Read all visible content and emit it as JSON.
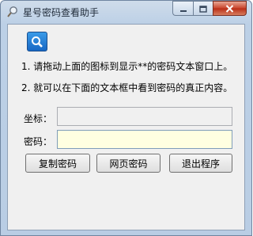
{
  "window": {
    "title": "星号密码查看助手"
  },
  "caption_buttons": {
    "minimize_icon": "minimize-icon",
    "maximize_icon": "maximize-icon",
    "close_icon": "close-icon"
  },
  "finder": {
    "icon": "magnifier-icon",
    "color": "#1e78d6"
  },
  "instructions": {
    "line1": "1. 请拖动上面的图标到显示**的密码文本窗口上。",
    "line2": "2. 就可以在下面的文本框中看到密码的真正内容。"
  },
  "fields": {
    "coord_label": "坐标：",
    "coord_value": "",
    "password_label": "密码：",
    "password_value": ""
  },
  "buttons": {
    "copy_password": "复制密码",
    "web_password": "网页密码",
    "exit": "退出程序"
  }
}
